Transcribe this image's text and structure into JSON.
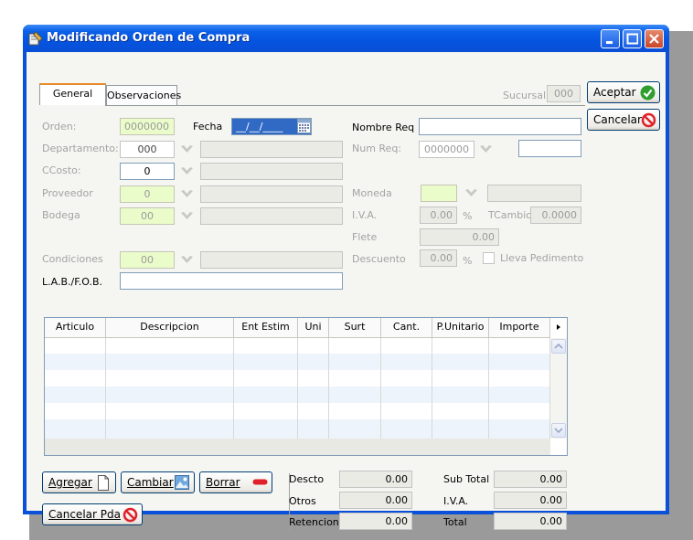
{
  "window": {
    "title": "Modificando Orden de Compra"
  },
  "tabs": [
    {
      "label": "General"
    },
    {
      "label": "Observaciones"
    }
  ],
  "sucursal": {
    "label": "Sucursal",
    "value": "000"
  },
  "buttons": {
    "aceptar": "Aceptar",
    "cancelar": "Cancelar",
    "agregar": "Agregar",
    "cambiar": "Cambiar",
    "borrar": "Borrar",
    "cancelar_pda": "Cancelar Pda"
  },
  "form": {
    "orden": {
      "label": "Orden:",
      "value": "0000000"
    },
    "fecha": {
      "label": "Fecha",
      "value": "__/__/____"
    },
    "departamento": {
      "label": "Departamento:",
      "value": "000",
      "desc": ""
    },
    "ccosto": {
      "label": "CCosto:",
      "value": "0",
      "desc": ""
    },
    "proveedor": {
      "label": "Proveedor",
      "value": "0",
      "desc": ""
    },
    "bodega": {
      "label": "Bodega",
      "value": "00",
      "desc": ""
    },
    "condiciones": {
      "label": "Condiciones",
      "value": "00",
      "desc": ""
    },
    "lab_fob": {
      "label": "L.A.B./F.O.B.",
      "value": ""
    },
    "nombre_req": {
      "label": "Nombre Req",
      "value": ""
    },
    "num_req": {
      "label": "Num Req:",
      "value": "0000000",
      "extra": ""
    },
    "moneda": {
      "label": "Moneda",
      "value": "",
      "desc": ""
    },
    "iva": {
      "label": "I.V.A.",
      "value": "0.00",
      "unit": "%"
    },
    "tcambio": {
      "label": "TCambio",
      "value": "0.0000"
    },
    "flete": {
      "label": "Flete",
      "value": "0.00"
    },
    "descuento": {
      "label": "Descuento",
      "value": "0.00",
      "unit": "%"
    },
    "lleva_pedimento": {
      "label": "Lleva Pedimento",
      "checked": false
    }
  },
  "grid": {
    "columns": [
      "Articulo",
      "Descripcion",
      "Ent Estim",
      "Uni",
      "Surt",
      "Cant.",
      "P.Unitario",
      "Importe"
    ],
    "rows": []
  },
  "totals": {
    "descto": {
      "label": "Descto",
      "value": "0.00"
    },
    "otros": {
      "label": "Otros",
      "value": "0.00"
    },
    "retencion": {
      "label": "Retencion",
      "value": "0.00"
    },
    "sub_total": {
      "label": "Sub Total",
      "value": "0.00"
    },
    "iva": {
      "label": "I.V.A.",
      "value": "0.00"
    },
    "total": {
      "label": "Total",
      "value": "0.00"
    }
  },
  "colors": {
    "titlebar": "#0a5fe8",
    "highlight_field": "#ebfccb",
    "date_field": "#316ac5"
  }
}
